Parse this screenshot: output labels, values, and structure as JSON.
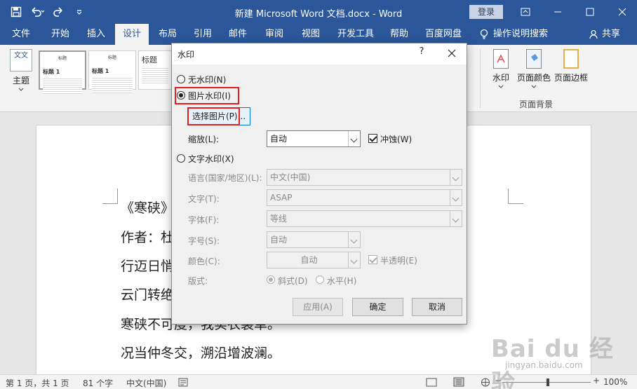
{
  "window": {
    "title": "新建 Microsoft Word 文档.docx  -  Word",
    "login_label": "登录"
  },
  "tabs": [
    "文件",
    "开始",
    "插入",
    "设计",
    "布局",
    "引用",
    "邮件",
    "审阅",
    "视图",
    "开发工具",
    "帮助",
    "百度网盘"
  ],
  "active_tab": "设计",
  "tell_me": "操作说明搜索",
  "share": "共享",
  "ribbon": {
    "theme_label": "主题",
    "theme_icon_text": "文文",
    "gallery": [
      {
        "title": "标题",
        "heading": "标题 1"
      },
      {
        "title": "标题",
        "heading": "标题 1"
      },
      {
        "title": "标题",
        "heading": "标题 1"
      }
    ],
    "buttons": {
      "watermark": "水印",
      "page_color": "页面颜色",
      "page_border": "页面边框"
    },
    "group_label": "页面背景"
  },
  "document": {
    "lines": [
      "《寒硖》",
      "作者：杜",
      "行迈日悄",
      "云门转绝",
      "寒硖不可度，我实衣裳单。",
      "况当仲冬交，溯沿增波澜。"
    ]
  },
  "status": {
    "page": "第 1 页，共 1 页",
    "words": "81 个字",
    "language": "中文(中国)",
    "zoom": "100%"
  },
  "dialog": {
    "title": "水印",
    "help": "?",
    "no_watermark": "无水印(N)",
    "picture_watermark": "图片水印(I)",
    "select_picture": "选择图片(P)...",
    "scale_label": "缩放(L):",
    "scale_value": "自动",
    "washout_label": "冲蚀(W)",
    "washout_checked": true,
    "text_watermark": "文字水印(X)",
    "language_label": "语言(国家/地区)(L):",
    "language_value": "中文(中国)",
    "text_label": "文字(T):",
    "text_value": "ASAP",
    "font_label": "字体(F):",
    "font_value": "等线",
    "size_label": "字号(S):",
    "size_value": "自动",
    "color_label": "颜色(C):",
    "color_value": "自动",
    "semi_transparent_label": "半透明(E)",
    "semi_transparent_checked": true,
    "layout_label": "版式:",
    "diagonal_label": "斜式(D)",
    "horizontal_label": "水平(H)",
    "apply_button": "应用(A)",
    "ok_button": "确定",
    "cancel_button": "取消",
    "selected_option": "picture"
  },
  "watermark_overlay": {
    "main": "Bai du 经验",
    "sub": "jingyan.baidu.com"
  },
  "colors": {
    "word_blue": "#2b579a",
    "highlight_red": "#e02020"
  }
}
